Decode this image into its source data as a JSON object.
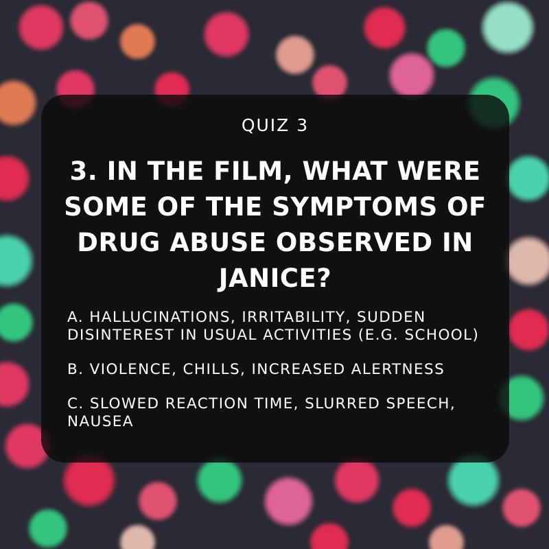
{
  "quiz": {
    "label": "QUIZ 3",
    "question": "3. IN THE FILM, WHAT WERE SOME OF THE SYMPTOMS OF DRUG ABUSE OBSERVED IN JANICE?",
    "options": [
      {
        "text": "A. HALLUCINATIONS, IRRITABILITY, SUDDEN DISINTEREST IN USUAL ACTIVITIES (E.G. SCHOOL)"
      },
      {
        "text": "B. VIOLENCE, CHILLS, INCREASED ALERTNESS"
      },
      {
        "text": "C. SLOWED REACTION TIME, SLURRED SPEECH, NAUSEA"
      }
    ]
  },
  "colors": {
    "background": "#2a2a34",
    "card": "#0a0a0a",
    "text": "#ffffff",
    "bokeh": [
      "#ff3b6b",
      "#ff5a7a",
      "#ff8a5a",
      "#ffb0a0",
      "#35e08a",
      "#4ff0c0",
      "#ff2d55",
      "#a9ffe0",
      "#ff6fa8",
      "#ffd0c0"
    ]
  }
}
